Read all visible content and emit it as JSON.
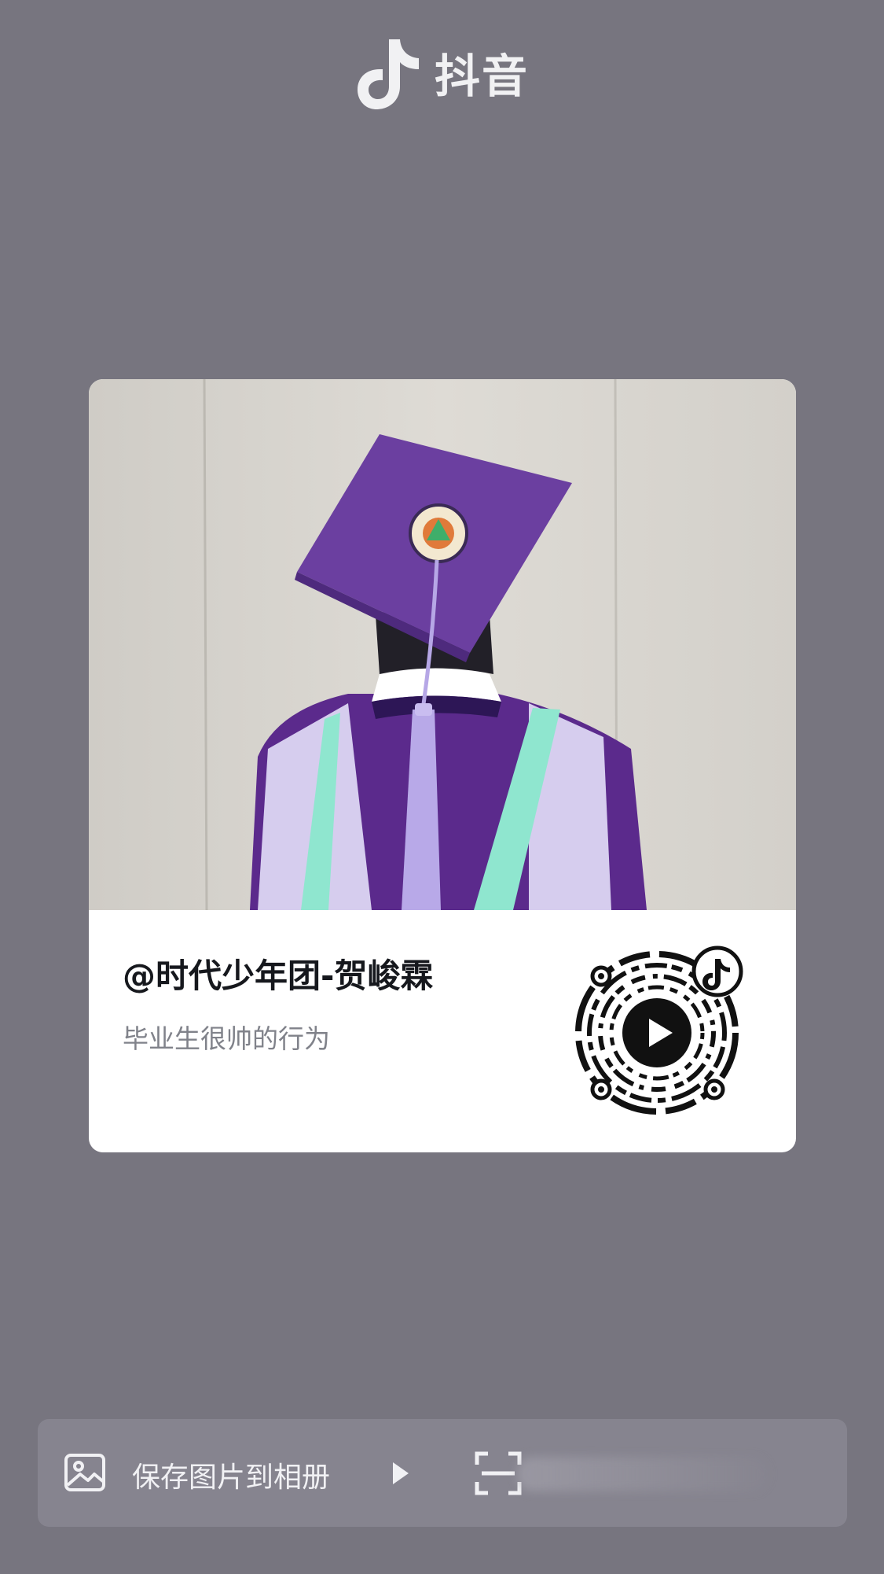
{
  "header": {
    "app_name": "抖音",
    "logo_icon": "tiktok-note-icon"
  },
  "card": {
    "author": "@时代少年团-贺峻霖",
    "description": "毕业生很帅的行为",
    "photo": "graduate-back-view-photo",
    "qr_icon": "tiktok-qr-code",
    "colors": {
      "gown_purple": "#5b2a8c",
      "stole_lavender": "#cfc4ec",
      "stole_mint": "#8fe6cf",
      "wall": "#d8d6d0"
    }
  },
  "bottom_bar": {
    "save_label": "保存图片到相册",
    "save_icon": "image-icon",
    "arrow_icon": "play-triangle-icon",
    "scan_icon": "scan-icon"
  },
  "colors": {
    "page_background": "#77757f",
    "bar_background": "#86848f"
  }
}
